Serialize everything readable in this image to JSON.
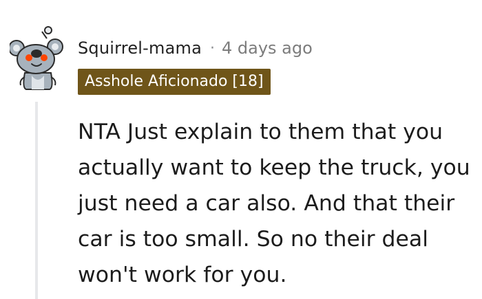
{
  "comment": {
    "username": "Squirrel-mama",
    "separator": "·",
    "timestamp": "4 days ago",
    "flair": "Asshole Aficionado [18]",
    "body": "NTA Just explain to them that you actually want to keep the truck, you just need a car also. And that their car is too small. So no their deal won't work for you."
  },
  "colors": {
    "flair_bg": "#6f5519",
    "avatar_body": "#a7b2bc",
    "eye_accent": "#ff4500"
  },
  "icons": {
    "avatar": "reddit-snoo-koala-avatar-icon"
  }
}
